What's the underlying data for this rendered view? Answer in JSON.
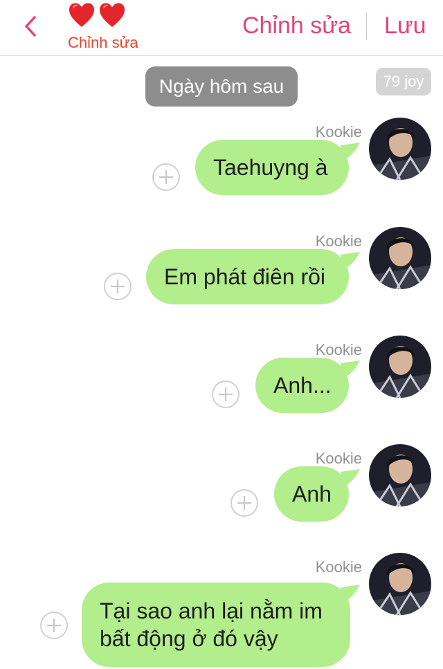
{
  "header": {
    "back_icon": "chevron-left-icon",
    "hearts": [
      "heart-icon",
      "heart-icon"
    ],
    "subtitle": "Chỉnh sửa",
    "edit_label": "Chỉnh sửa",
    "save_label": "Lưu",
    "accent_color": "#e6427a",
    "subtitle_color": "#e8432c"
  },
  "date_label": "Ngày hôm sau",
  "counter_label": "79 joy",
  "bubble_color": "#b2ee8c",
  "messages": [
    {
      "sender": "Kookie",
      "text": "Taehuyng à"
    },
    {
      "sender": "Kookie",
      "text": "Em phát điên rồi"
    },
    {
      "sender": "Kookie",
      "text": "Anh..."
    },
    {
      "sender": "Kookie",
      "text": "Anh"
    },
    {
      "sender": "Kookie",
      "text": "Tại sao anh lại nằm im bất động ở đó vậy"
    }
  ]
}
